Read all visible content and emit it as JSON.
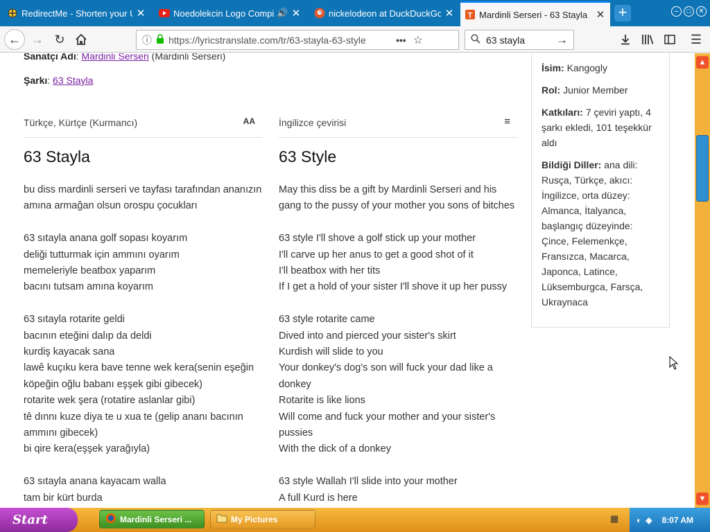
{
  "tabs": [
    {
      "label": "RedirectMe - Shorten your URL",
      "icon": "redirect-icon",
      "active": false
    },
    {
      "label": "Noedolekcin Logo Compilation",
      "icon": "youtube-icon",
      "active": false
    },
    {
      "label": "nickelodeon at DuckDuckGo",
      "icon": "duckduckgo-icon",
      "active": false
    },
    {
      "label": "Mardinli Serseri - 63 Stayla",
      "icon": "lyricstranslate-icon",
      "active": true
    }
  ],
  "toolbar": {
    "url": "https://lyricstranslate.com/tr/63-stayla-63-style",
    "search_value": "63 stayla"
  },
  "page": {
    "artist_label": "Sanatçı Adı",
    "artist_value": "Mardinli Serseri",
    "artist_suffix": "(Mardinli Serseri)",
    "song_label": "Şarkı",
    "song_value": "63 Stayla",
    "left_lang": "Türkçe, Kürtçe (Kurmancı)",
    "right_lang": "İngilizce çevirisi",
    "font_toggle": "AA",
    "left_title": "63 Stayla",
    "right_title": "63 Style",
    "left_lyrics": [
      [
        "bu diss mardinli serseri ve tayfası tarafından ananızın",
        "amına armağan olsun orospu çocukları"
      ],
      [
        "63 sıtayla anana golf sopası koyarım",
        "deliği tutturmak için ammını oyarım",
        "memeleriyle beatbox yaparım",
        "bacını tutsam amına koyarım"
      ],
      [
        "63 sıtayla rotarite geldi",
        "bacının eteğini dalıp da deldi",
        "kurdiş kayacak sana",
        "lawê kuçıku kera bave tenne wek kera(senin eşeğin",
        "köpeğin oğlu babanı eşşek gibi gibecek)",
        "rotarite wek şera (rotatire aslanlar gibi)",
        "tê dınnı kuze diya te u xua te (gelip ananı bacının",
        "ammını gibecek)",
        "bi qire kera(eşşek yarağıyla)"
      ],
      [
        "63 sıtayla anana kayacam walla",
        "tam bir kürt burda"
      ]
    ],
    "right_lyrics": [
      [
        "May this diss be a gift by Mardinli Serseri and his",
        "gang to the pussy of your mother you sons of bitches"
      ],
      [
        "63 style I'll shove a golf stick up your mother",
        "I'll carve up her anus to get a good shot of it",
        "I'll beatbox with her tits",
        "If I get a hold of your sister I'll shove it up her pussy"
      ],
      [
        "63 style rotarite came",
        "Dived into and pierced your sister's skirt",
        "Kurdish will slide to you",
        "Your donkey's dog's son will fuck your dad like a",
        "donkey",
        "Rotarite is like lions",
        "Will come and fuck your mother and your sister's",
        "pussies",
        "With the dick of a donkey"
      ],
      [
        "63 style Wallah I'll slide into your mother",
        "A full Kurd is here"
      ]
    ]
  },
  "sidebar": {
    "name_label": "İsim:",
    "name_value": "Kangogly",
    "role_label": "Rol:",
    "role_value": "Junior Member",
    "contrib_label": "Katkıları:",
    "contrib_value": "7 çeviri yaptı, 4 şarkı ekledi, 101 teşekkür aldı",
    "langs_label": "Bildiği Diller:",
    "langs_value": "ana dili: Rusça, Türkçe, akıcı: İngilizce, orta düzey: Almanca, İtalyanca, başlangıç düzeyinde: Çince, Felemenkçe, Fransızca, Macarca, Japonca, Latince, Lüksemburgca, Farsça, Ukraynaca"
  },
  "taskbar": {
    "start_label": "Start",
    "tasks": [
      {
        "label": "Mardinli Serseri ...",
        "icon": "firefox-icon"
      },
      {
        "label": "My Pictures",
        "icon": "folder-icon"
      }
    ],
    "clock": "8:07 AM"
  },
  "colors": {
    "tabstrip": "#0e74b6",
    "accent": "#0a84ff",
    "taskbar": "#f2a12c",
    "start": "#a93cb8"
  }
}
